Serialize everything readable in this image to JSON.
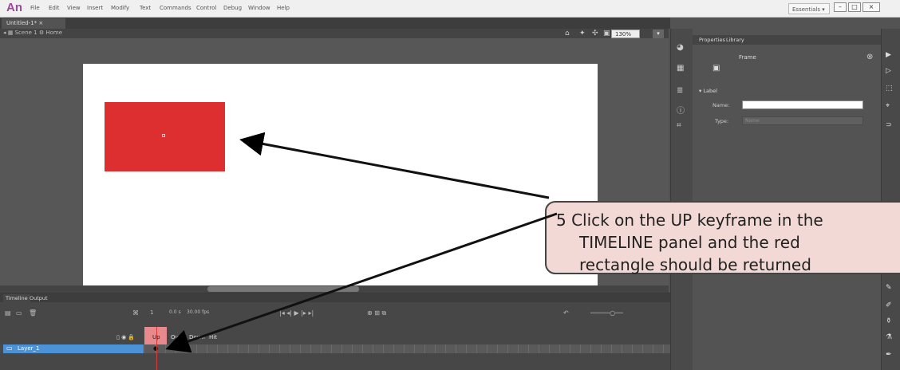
{
  "app": {
    "logo": "An",
    "doc_tab": "Untitled-1* ×",
    "workspace": "Essentials"
  },
  "menu": [
    "File",
    "Edit",
    "View",
    "Insert",
    "Modify",
    "Text",
    "Commands",
    "Control",
    "Debug",
    "Window",
    "Help"
  ],
  "editbar": {
    "breadcrumb": "Scene 1",
    "symbol": "Home",
    "zoom": "130%"
  },
  "timeline": {
    "tabs": [
      "Timeline",
      "Output"
    ],
    "frame": "1",
    "time": "0.0 s",
    "fps": "30.00 fps",
    "frame_headers": [
      "Up",
      "Over",
      "Down",
      "Hit"
    ],
    "layer_name": "Layer_1"
  },
  "properties": {
    "tabs": [
      "Properties",
      "Library"
    ],
    "title": "Frame",
    "section": "Label",
    "name_label": "Name:",
    "type_label": "Type:",
    "type_value": "Name",
    "name_value": ""
  },
  "callout": {
    "lines": [
      "5  Click on the UP keyframe in the",
      "TIMELINE panel and the red",
      "rectangle should be returned"
    ]
  },
  "colors": {
    "accent": "#dd2f2f",
    "layer_highlight": "#4b92d6",
    "callout_bg": "#f2d9d5"
  }
}
